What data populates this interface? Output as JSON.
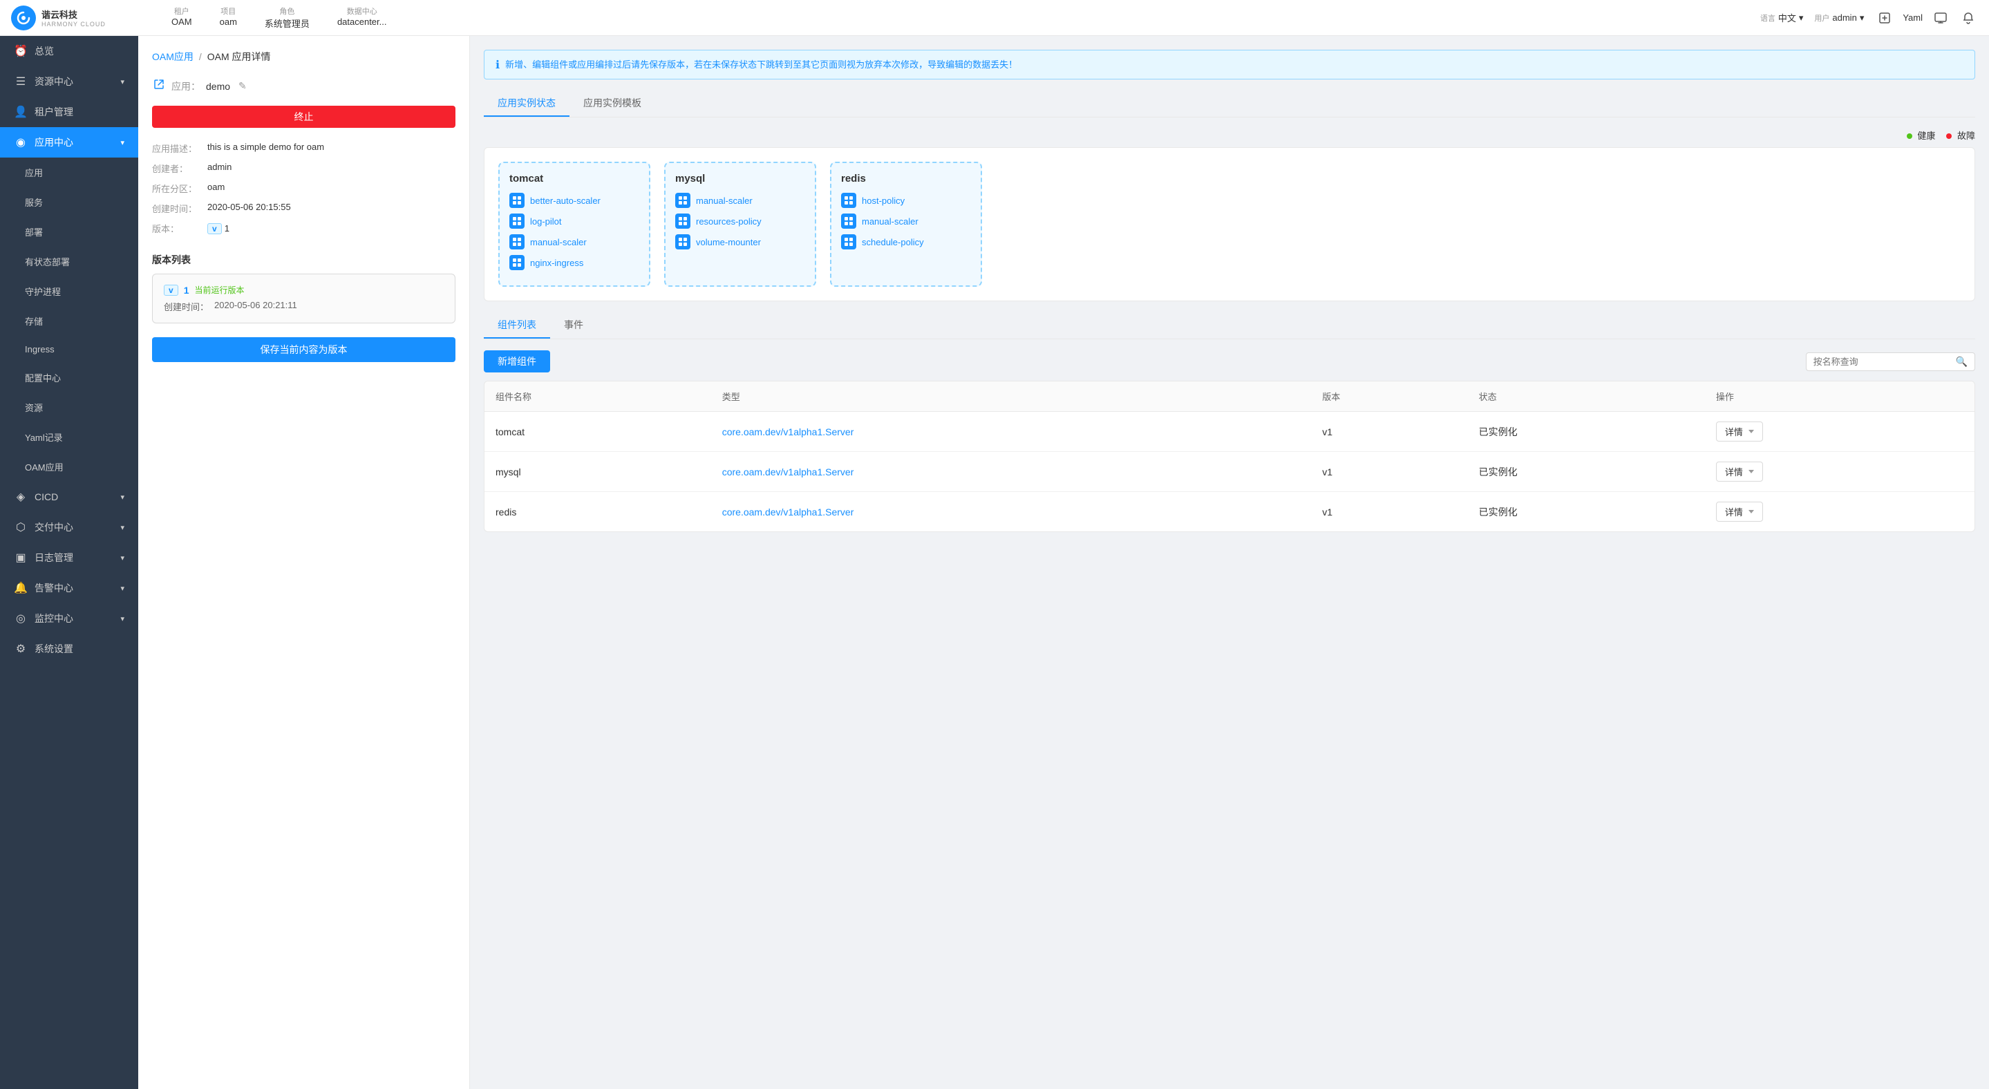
{
  "topbar": {
    "logo_text_line1": "谐云科技",
    "logo_text_line2": "HARMONY CLOUD",
    "tenant_label": "租户",
    "tenant_value": "OAM",
    "project_label": "项目",
    "project_value": "oam",
    "role_label": "角色",
    "role_value": "系统管理员",
    "datacenter_label": "数据中心",
    "datacenter_value": "datacenter...",
    "lang_label": "语言",
    "lang_value": "中文",
    "user_label": "用户",
    "user_value": "admin",
    "yamlrecord_label": "Yaml"
  },
  "sidebar": {
    "items": [
      {
        "label": "总览",
        "icon": "⏰",
        "active": false,
        "indent": false
      },
      {
        "label": "资源中心",
        "icon": "☰",
        "active": false,
        "indent": false,
        "arrow": "▾"
      },
      {
        "label": "租户管理",
        "icon": "👤",
        "active": false,
        "indent": false
      },
      {
        "label": "应用中心",
        "icon": "◉",
        "active": true,
        "indent": false,
        "arrow": "▾"
      },
      {
        "label": "应用",
        "icon": "",
        "active": false,
        "indent": true
      },
      {
        "label": "服务",
        "icon": "",
        "active": false,
        "indent": true
      },
      {
        "label": "部署",
        "icon": "",
        "active": false,
        "indent": true
      },
      {
        "label": "有状态部署",
        "icon": "",
        "active": false,
        "indent": true
      },
      {
        "label": "守护进程",
        "icon": "",
        "active": false,
        "indent": true
      },
      {
        "label": "存储",
        "icon": "",
        "active": false,
        "indent": true
      },
      {
        "label": "Ingress",
        "icon": "",
        "active": false,
        "indent": true
      },
      {
        "label": "配置中心",
        "icon": "",
        "active": false,
        "indent": true
      },
      {
        "label": "资源",
        "icon": "",
        "active": false,
        "indent": true
      },
      {
        "label": "Yaml记录",
        "icon": "",
        "active": false,
        "indent": true
      },
      {
        "label": "OAM应用",
        "icon": "",
        "active": false,
        "indent": true
      },
      {
        "label": "CICD",
        "icon": "◈",
        "active": false,
        "indent": false,
        "arrow": "▾"
      },
      {
        "label": "交付中心",
        "icon": "⬡",
        "active": false,
        "indent": false,
        "arrow": "▾"
      },
      {
        "label": "日志管理",
        "icon": "▣",
        "active": false,
        "indent": false,
        "arrow": "▾"
      },
      {
        "label": "告警中心",
        "icon": "🔔",
        "active": false,
        "indent": false,
        "arrow": "▾"
      },
      {
        "label": "监控中心",
        "icon": "◎",
        "active": false,
        "indent": false,
        "arrow": "▾"
      },
      {
        "label": "系统设置",
        "icon": "⚙",
        "active": false,
        "indent": false
      }
    ]
  },
  "breadcrumb": {
    "link": "OAM应用",
    "sep": "/",
    "current": "OAM 应用详情"
  },
  "left_panel": {
    "app_label": "应用：",
    "app_value": "demo",
    "stop_btn": "终止",
    "desc_label": "应用描述：",
    "desc_value": "this is a simple demo for oam",
    "creator_label": "创建者：",
    "creator_value": "admin",
    "zone_label": "所在分区：",
    "zone_value": "oam",
    "created_label": "创建时间：",
    "created_value": "2020-05-06 20:15:55",
    "version_label": "版本：",
    "version_value": "1",
    "version_badge": "v",
    "version_section": "版本列表",
    "version_card": {
      "badge": "v",
      "num": "1",
      "tag": "当前运行版本",
      "created_label": "创建时间：",
      "created_value": "2020-05-06 20:21:11"
    },
    "save_btn": "保存当前内容为版本"
  },
  "right_panel": {
    "alert_text": "新增、编辑组件或应用编排过后请先保存版本，若在未保存状态下跳转到至其它页面则视为放弃本次修改，导致编辑的数据丢失！",
    "tabs": [
      {
        "label": "应用实例状态",
        "active": true
      },
      {
        "label": "应用实例模板",
        "active": false
      }
    ],
    "legend_healthy": "健康",
    "legend_error": "故障",
    "topology": {
      "nodes": [
        {
          "title": "tomcat",
          "items": [
            "better-auto-scaler",
            "log-pilot",
            "manual-scaler",
            "nginx-ingress"
          ]
        },
        {
          "title": "mysql",
          "items": [
            "manual-scaler",
            "resources-policy",
            "volume-mounter"
          ]
        },
        {
          "title": "redis",
          "items": [
            "host-policy",
            "manual-scaler",
            "schedule-policy"
          ]
        }
      ]
    },
    "comp_tabs": [
      {
        "label": "组件列表",
        "active": true
      },
      {
        "label": "事件",
        "active": false
      }
    ],
    "add_btn": "新增组件",
    "search_placeholder": "按名称查询",
    "table": {
      "headers": [
        "组件名称",
        "类型",
        "版本",
        "状态",
        "操作"
      ],
      "rows": [
        {
          "name": "tomcat",
          "type": "core.oam.dev/v1alpha1.Server",
          "version": "v1",
          "status": "已实例化",
          "action": "详情"
        },
        {
          "name": "mysql",
          "type": "core.oam.dev/v1alpha1.Server",
          "version": "v1",
          "status": "已实例化",
          "action": "详情"
        },
        {
          "name": "redis",
          "type": "core.oam.dev/v1alpha1.Server",
          "version": "v1",
          "status": "已实例化",
          "action": "详情"
        }
      ]
    }
  }
}
